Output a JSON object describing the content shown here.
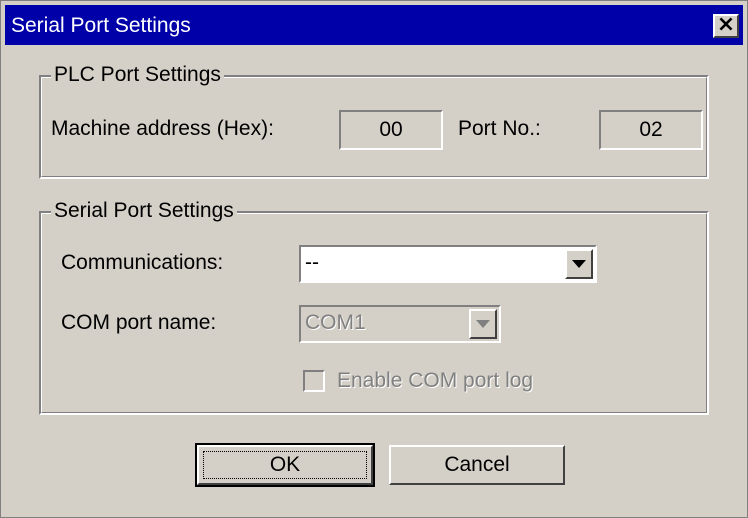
{
  "window": {
    "title": "Serial Port Settings",
    "close_glyph": "×"
  },
  "plc_group": {
    "legend": "PLC Port Settings",
    "machine_address_label": "Machine address (Hex):",
    "machine_address_value": "00",
    "port_no_label": "Port No.:",
    "port_no_value": "02"
  },
  "serial_group": {
    "legend": "Serial Port Settings",
    "communications_label": "Communications:",
    "communications_value": "--",
    "com_port_label": "COM port name:",
    "com_port_value": "COM1",
    "enable_log_label": "Enable COM port log",
    "enable_log_checked": false
  },
  "buttons": {
    "ok": "OK",
    "cancel": "Cancel"
  },
  "icons": {
    "close": "close-icon",
    "dropdown": "chevron-down-icon"
  }
}
